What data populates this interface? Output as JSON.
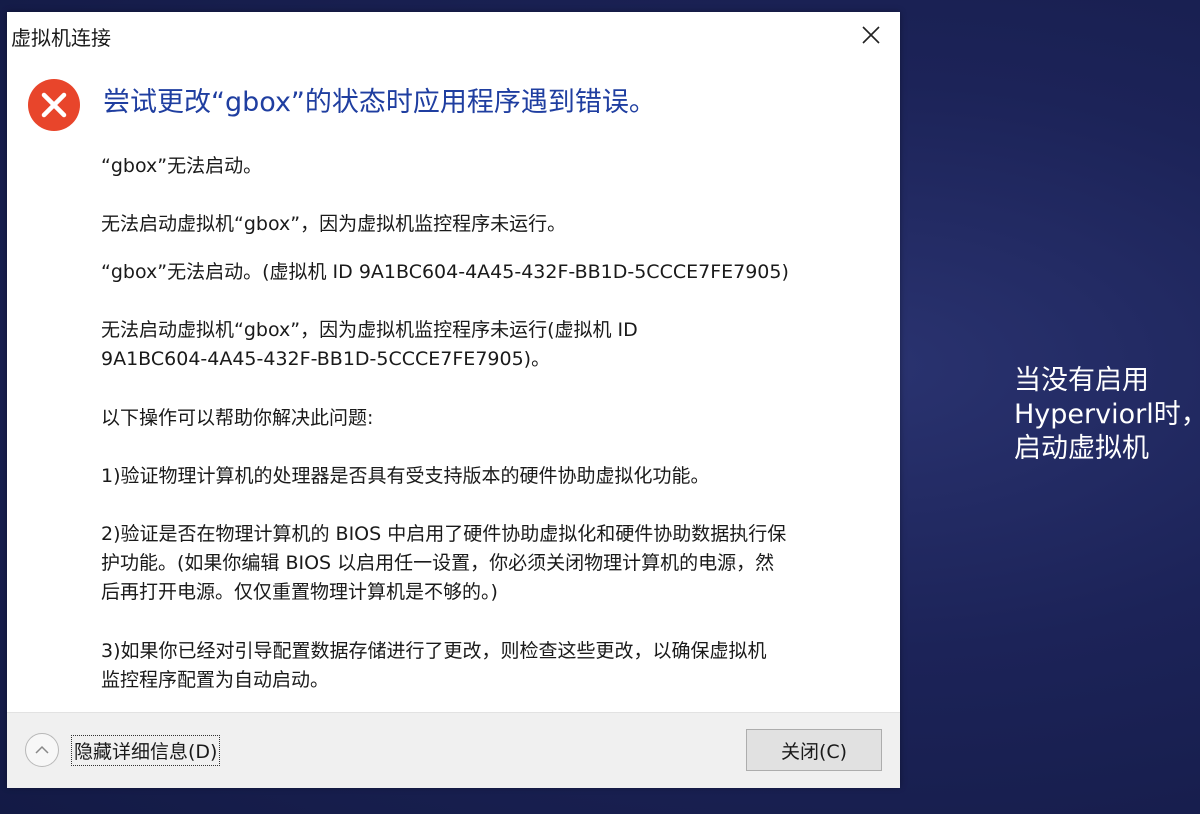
{
  "window": {
    "title": "虚拟机连接",
    "close_icon": "close-icon"
  },
  "error": {
    "icon": "error-x-icon",
    "icon_color": "#e8452b",
    "headline": "尝试更改“gbox”的状态时应用程序遇到错误。",
    "headline_color": "#1f3ea0",
    "paragraphs": [
      "“gbox”无法启动。",
      "无法启动虚拟机“gbox”，因为虚拟机监控程序未运行。",
      "“gbox”无法启动。(虚拟机 ID 9A1BC604-4A45-432F-BB1D-5CCCE7FE7905)",
      "无法启动虚拟机“gbox”，因为虚拟机监控程序未运行(虚拟机 ID\n9A1BC604-4A45-432F-BB1D-5CCCE7FE7905)。",
      "以下操作可以帮助你解决此问题:",
      "1)验证物理计算机的处理器是否具有受支持版本的硬件协助虚拟化功能。",
      "2)验证是否在物理计算机的 BIOS 中启用了硬件协助虚拟化和硬件协助数据执行保\n护功能。(如果你编辑 BIOS 以启用任一设置，你必须关闭物理计算机的电源，然\n后再打开电源。仅仅重置物理计算机是不够的。)",
      "3)如果你已经对引导配置数据存储进行了更改，则检查这些更改，以确保虚拟机\n监控程序配置为自动启动。"
    ]
  },
  "footer": {
    "toggle_icon": "chevron-up-icon",
    "details_label": "隐藏详细信息(D)",
    "close_label": "关闭(C)"
  },
  "side_note": {
    "lines": [
      "当没有启用",
      "Hyperviorl时，",
      "启动虚拟机"
    ]
  }
}
